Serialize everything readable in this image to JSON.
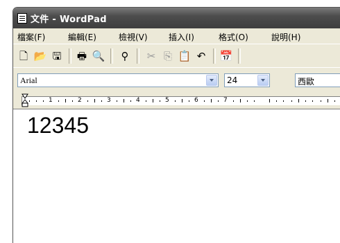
{
  "window": {
    "title": "文件 - WordPad"
  },
  "menu": {
    "items": [
      {
        "label": "檔案(F)"
      },
      {
        "label": "編輯(E)"
      },
      {
        "label": "檢視(V)"
      },
      {
        "label": "插入(I)"
      },
      {
        "label": "格式(O)"
      },
      {
        "label": "說明(H)"
      }
    ]
  },
  "toolbar": {
    "icons": [
      "new-document-icon",
      "open-folder-icon",
      "save-disk-icon",
      "print-icon",
      "print-preview-icon",
      "find-binoculars-icon",
      "cut-scissors-icon",
      "copy-icon",
      "paste-icon",
      "undo-icon",
      "insert-datetime-icon"
    ]
  },
  "format": {
    "font": "Arial",
    "size": "24",
    "script": "西歐"
  },
  "ruler": {
    "labels": [
      "1",
      "2",
      "3",
      "4",
      "5",
      "6",
      "7"
    ]
  },
  "document": {
    "text": "12345"
  }
}
